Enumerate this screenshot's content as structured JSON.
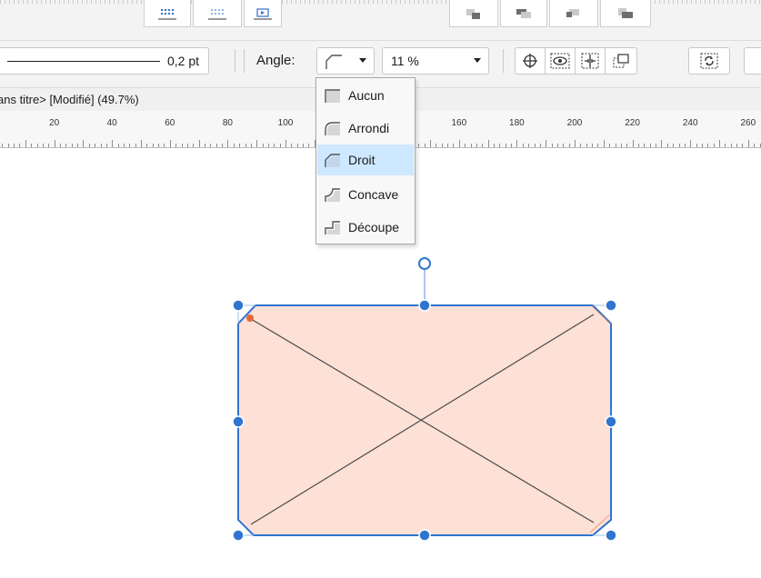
{
  "context_toolbar": {
    "line_weight": "0,2 pt",
    "angle_label": "Angle:",
    "corner_percent": "11 %"
  },
  "corner_menu": {
    "items": [
      {
        "label": "Aucun",
        "icon": "corner-none-icon",
        "selected": false
      },
      {
        "label": "Arrondi",
        "icon": "corner-rounded-icon",
        "selected": false
      },
      {
        "label": "Droit",
        "icon": "corner-straight-icon",
        "selected": true
      },
      {
        "label": "Concave",
        "icon": "corner-concave-icon",
        "selected": false
      },
      {
        "label": "Découpe",
        "icon": "corner-cutout-icon",
        "selected": false
      }
    ]
  },
  "document": {
    "title": "ans titre> [Modifié] (49.7%)"
  },
  "ruler": {
    "labels": [
      "20",
      "40",
      "60",
      "80",
      "100",
      "160",
      "180",
      "200",
      "220",
      "240",
      "260"
    ]
  },
  "colors": {
    "selection_blue": "#2f75d0",
    "shape_fill": "#fde0d6",
    "corner_handle": "#e06a3a",
    "menu_highlight": "#cde8ff"
  }
}
